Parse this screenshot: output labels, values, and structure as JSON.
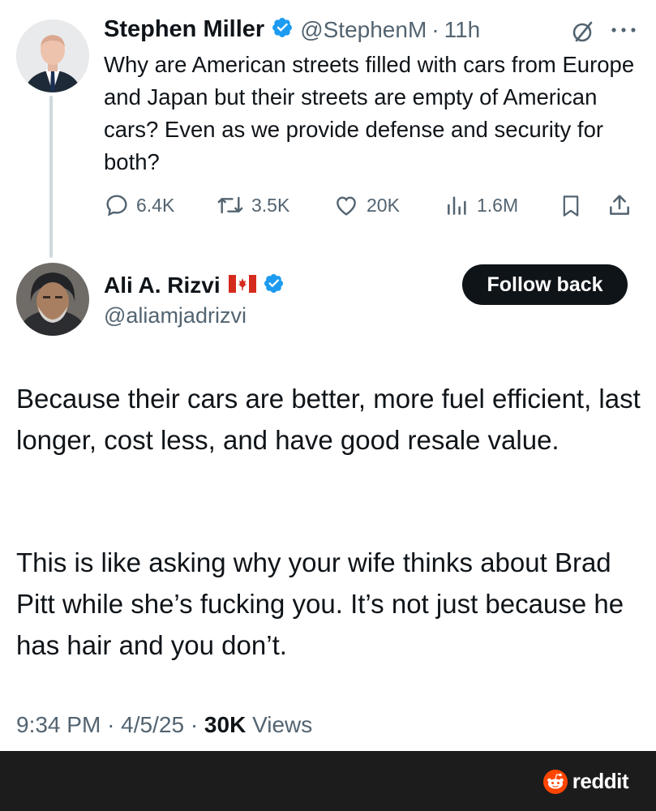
{
  "colors": {
    "verified": "#1d9bf0",
    "text_primary": "#0f1419",
    "text_secondary": "#536471",
    "follow_button_bg": "#0f1419",
    "reddit_orange": "#ff4500",
    "footer_bg": "#1c1c1c"
  },
  "parent_tweet": {
    "avatar_icon": "profile-photo",
    "display_name": "Stephen Miller",
    "handle": "@StephenM",
    "separator": "·",
    "time_ago": "11h",
    "text": "Why are American streets filled with cars from Europe and Japan but their streets are empty of American cars? Even as we provide defense and security for both?",
    "actions": {
      "replies": "6.4K",
      "reposts": "3.5K",
      "likes": "20K",
      "views": "1.6M"
    }
  },
  "reply": {
    "display_name": "Ali A. Rizvi",
    "flag_icon": "canada-flag-icon",
    "handle": "@aliamjadrizvi",
    "follow_label": "Follow back",
    "paragraphs": [
      "Because their cars are better, more fuel efficient, last longer, cost less, and have good resale value.",
      "This is like asking why your wife thinks about Brad Pitt while she’s fucking you. It’s not just because he has hair and you don’t."
    ],
    "meta": {
      "time": "9:34 PM",
      "separator": "·",
      "date": "4/5/25",
      "views_count": "30K",
      "views_label": "Views"
    }
  },
  "footer": {
    "brand": "reddit",
    "icon": "reddit-snoo-icon"
  }
}
